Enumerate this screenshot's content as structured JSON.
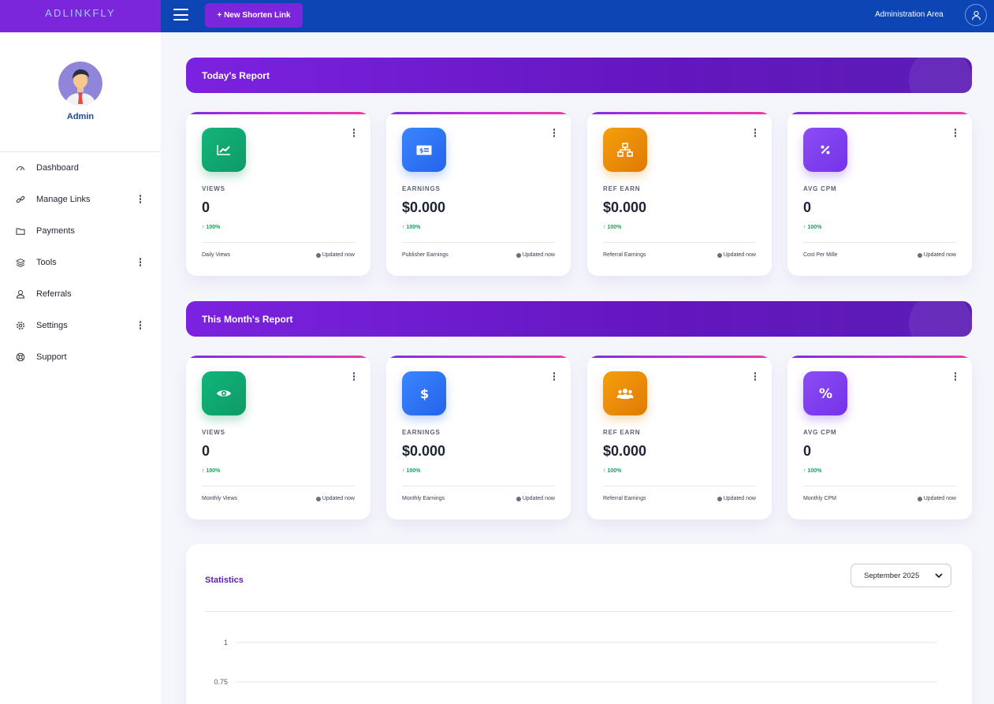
{
  "brand": "ADLINKFLY",
  "topbar": {
    "new_link": "+ New Shorten Link",
    "admin_area": "Administration Area"
  },
  "sidebar": {
    "user_name": "Admin",
    "items": [
      {
        "label": "Dashboard",
        "icon": "speedometer-icon",
        "has_submenu": false
      },
      {
        "label": "Manage Links",
        "icon": "link-icon",
        "has_submenu": true
      },
      {
        "label": "Payments",
        "icon": "folder-icon",
        "has_submenu": false
      },
      {
        "label": "Tools",
        "icon": "layers-icon",
        "has_submenu": true
      },
      {
        "label": "Referrals",
        "icon": "user-icon",
        "has_submenu": false
      },
      {
        "label": "Settings",
        "icon": "gear-icon",
        "has_submenu": true
      },
      {
        "label": "Support",
        "icon": "lifebuoy-icon",
        "has_submenu": false
      }
    ]
  },
  "today": {
    "title": "Today's Report",
    "cards": [
      {
        "label": "VIEWS",
        "value": "0",
        "pct": "100%",
        "foot": "Daily Views",
        "updated": "Updated now",
        "icon": "chart-icon",
        "color": "#12b57a"
      },
      {
        "label": "EARNINGS",
        "value": "$0.000",
        "pct": "100%",
        "foot": "Publisher Earnings",
        "updated": "Updated now",
        "icon": "money-bill-icon",
        "color": "#3a86ff"
      },
      {
        "label": "REF EARN",
        "value": "$0.000",
        "pct": "100%",
        "foot": "Referral Earnings",
        "updated": "Updated now",
        "icon": "sitemap-icon",
        "color": "#f59f0b"
      },
      {
        "label": "AVG CPM",
        "value": "0",
        "pct": "100%",
        "foot": "Cost Per Mille",
        "updated": "Updated now",
        "icon": "percent-icon",
        "color": "#8c4cf5"
      }
    ]
  },
  "month": {
    "title": "This Month's Report",
    "cards": [
      {
        "label": "VIEWS",
        "value": "0",
        "pct": "100%",
        "foot": "Monthly Views",
        "updated": "Updated now",
        "icon": "eye-icon",
        "color": "#12b57a"
      },
      {
        "label": "EARNINGS",
        "value": "$0.000",
        "pct": "100%",
        "foot": "Monthly Earnings",
        "updated": "Updated now",
        "icon": "dollar-icon",
        "color": "#3a86ff"
      },
      {
        "label": "REF EARN",
        "value": "$0.000",
        "pct": "100%",
        "foot": "Referral Earnings",
        "updated": "Updated now",
        "icon": "users-icon",
        "color": "#f59f0b"
      },
      {
        "label": "AVG CPM",
        "value": "0",
        "pct": "100%",
        "foot": "Monthly CPM",
        "updated": "Updated now",
        "icon": "percent-icon",
        "color": "#8c4cf5"
      }
    ]
  },
  "statistics": {
    "title": "Statistics",
    "selected_month": "September 2025"
  },
  "chart_data": {
    "type": "line",
    "title": "Statistics",
    "y_ticks": [
      1,
      0.75
    ],
    "ylim": [
      0,
      1
    ],
    "series": [],
    "grid": true
  }
}
